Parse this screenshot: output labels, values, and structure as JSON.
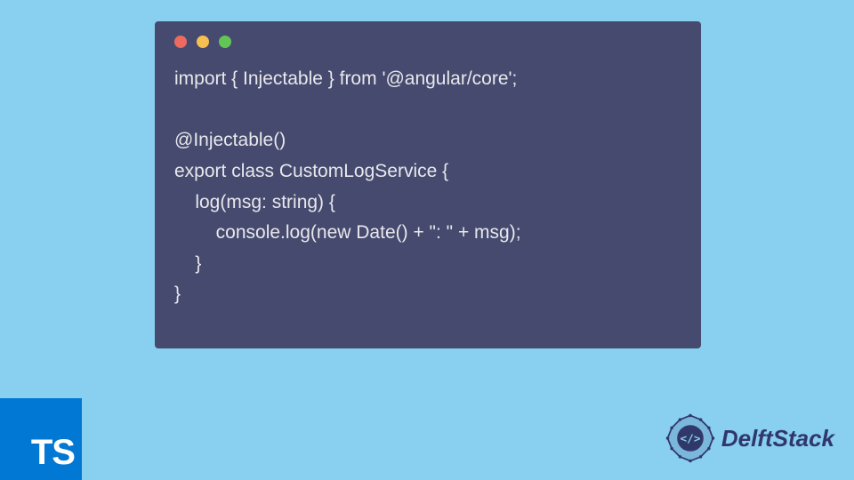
{
  "code": {
    "line1": "import { Injectable } from '@angular/core';",
    "line2": "",
    "line3": "@Injectable()",
    "line4": "export class CustomLogService {",
    "line5": "    log(msg: string) {",
    "line6": "        console.log(new Date() + \": \" + msg);",
    "line7": "    }",
    "line8": "}"
  },
  "ts_badge": "TS",
  "brand": "DelftStack",
  "colors": {
    "background": "#89cff0",
    "window": "#454a6e",
    "dot_red": "#ed6a5f",
    "dot_yellow": "#f5c04f",
    "dot_green": "#62c555",
    "ts_blue": "#0078d4",
    "brand_color": "#30386a"
  }
}
